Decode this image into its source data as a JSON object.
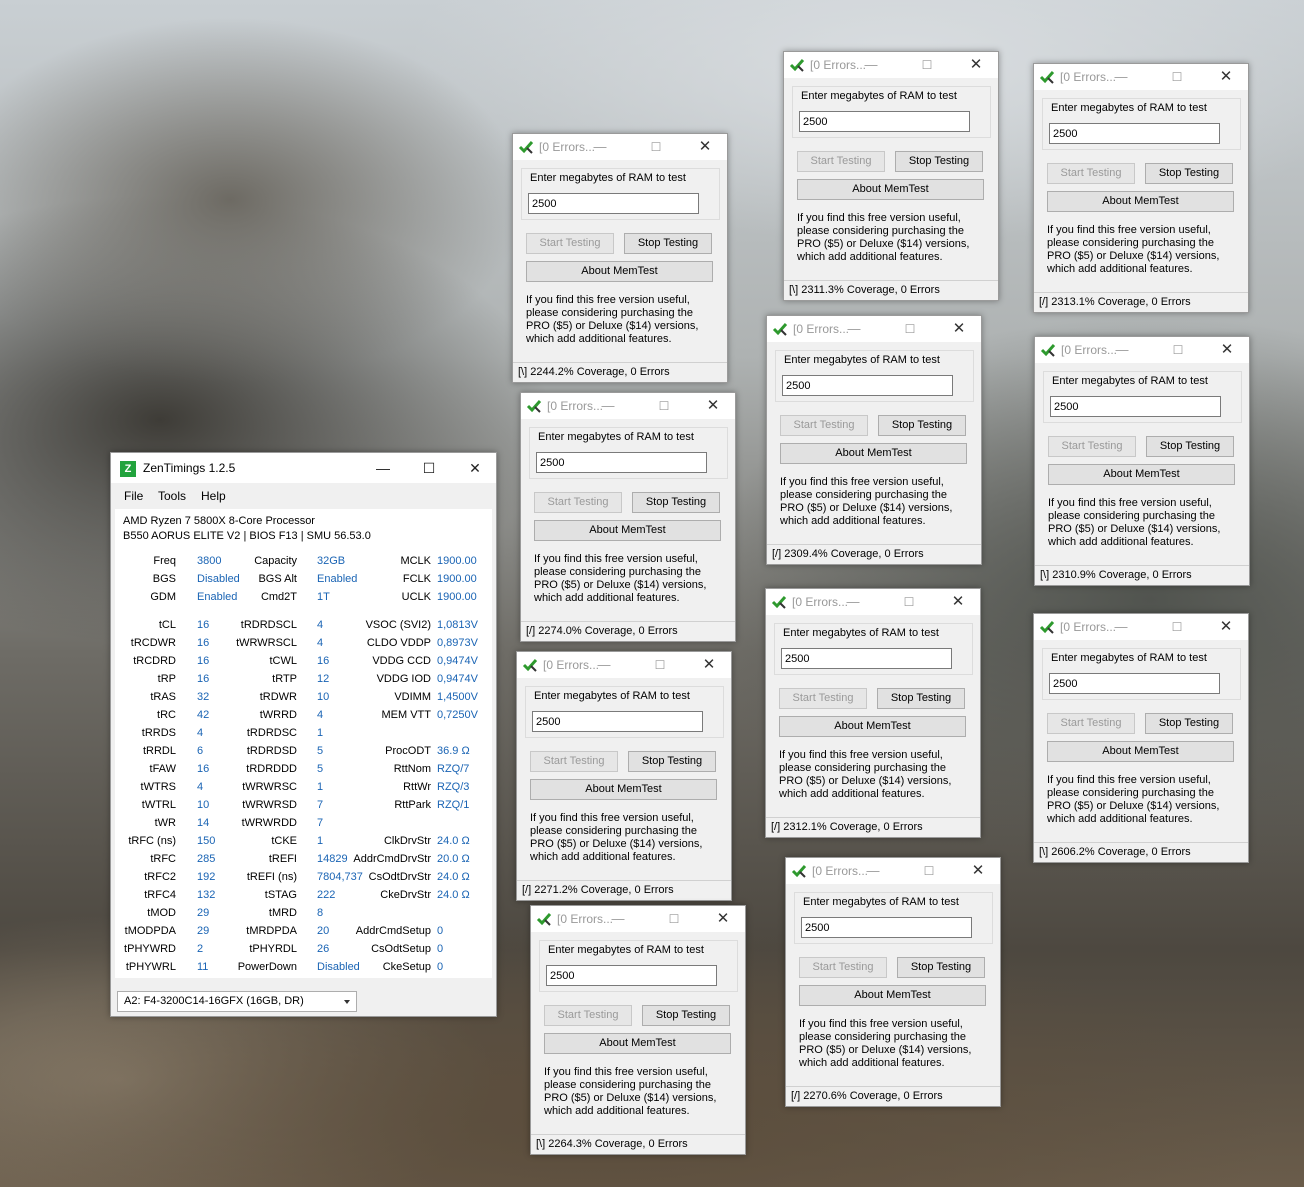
{
  "memtest_common": {
    "title": "[0 Errors...",
    "group_label": "Enter megabytes of RAM to test",
    "ram_value": "2500",
    "start_label": "Start Testing",
    "stop_label": "Stop Testing",
    "about_label": "About MemTest",
    "message": "If you find this free version useful, please considering purchasing the PRO ($5) or Deluxe ($14) versions, which add additional features."
  },
  "memtest_windows": [
    {
      "status": "[\\]   2244.2% Coverage, 0 Errors"
    },
    {
      "status": "[/]   2274.0% Coverage, 0 Errors"
    },
    {
      "status": "[/]   2271.2% Coverage, 0 Errors"
    },
    {
      "status": "[\\]   2264.3% Coverage, 0 Errors"
    },
    {
      "status": "[\\]   2311.3% Coverage, 0 Errors"
    },
    {
      "status": "[/]   2309.4% Coverage, 0 Errors"
    },
    {
      "status": "[/]   2312.1% Coverage, 0 Errors"
    },
    {
      "status": "[/]   2270.6% Coverage, 0 Errors"
    },
    {
      "status": "[/]   2313.1% Coverage, 0 Errors"
    },
    {
      "status": "[\\]   2310.9% Coverage, 0 Errors"
    },
    {
      "status": "[\\]   2606.2% Coverage, 0 Errors"
    }
  ],
  "zentimings": {
    "title": "ZenTimings 1.2.5",
    "menu": [
      "File",
      "Tools",
      "Help"
    ],
    "cpu": "AMD Ryzen 7 5800X 8-Core Processor",
    "board": "B550 AORUS ELITE V2 | BIOS F13 | SMU 56.53.0",
    "rows": [
      [
        "Freq",
        "3800",
        "Capacity",
        "32GB",
        "MCLK",
        "1900.00"
      ],
      [
        "BGS",
        "Disabled",
        "BGS Alt",
        "Enabled",
        "FCLK",
        "1900.00"
      ],
      [
        "GDM",
        "Enabled",
        "Cmd2T",
        "1T",
        "UCLK",
        "1900.00"
      ],
      [
        "tCL",
        "16",
        "tRDRDSCL",
        "4",
        "VSOC (SVI2)",
        "1,0813V"
      ],
      [
        "tRCDWR",
        "16",
        "tWRWRSCL",
        "4",
        "CLDO VDDP",
        "0,8973V"
      ],
      [
        "tRCDRD",
        "16",
        "tCWL",
        "16",
        "VDDG CCD",
        "0,9474V"
      ],
      [
        "tRP",
        "16",
        "tRTP",
        "12",
        "VDDG IOD",
        "0,9474V"
      ],
      [
        "tRAS",
        "32",
        "tRDWR",
        "10",
        "VDIMM",
        "1,4500V"
      ],
      [
        "tRC",
        "42",
        "tWRRD",
        "4",
        "MEM VTT",
        "0,7250V"
      ],
      [
        "tRRDS",
        "4",
        "tRDRDSC",
        "1",
        "",
        ""
      ],
      [
        "tRRDL",
        "6",
        "tRDRDSD",
        "5",
        "ProcODT",
        "36.9 Ω"
      ],
      [
        "tFAW",
        "16",
        "tRDRDDD",
        "5",
        "RttNom",
        "RZQ/7"
      ],
      [
        "tWTRS",
        "4",
        "tWRWRSC",
        "1",
        "RttWr",
        "RZQ/3"
      ],
      [
        "tWTRL",
        "10",
        "tWRWRSD",
        "7",
        "RttPark",
        "RZQ/1"
      ],
      [
        "tWR",
        "14",
        "tWRWRDD",
        "7",
        "",
        ""
      ],
      [
        "tRFC (ns)",
        "150",
        "tCKE",
        "1",
        "ClkDrvStr",
        "24.0 Ω"
      ],
      [
        "tRFC",
        "285",
        "tREFI",
        "14829",
        "AddrCmdDrvStr",
        "20.0 Ω"
      ],
      [
        "tRFC2",
        "192",
        "tREFI (ns)",
        "7804,737",
        "CsOdtDrvStr",
        "24.0 Ω"
      ],
      [
        "tRFC4",
        "132",
        "tSTAG",
        "222",
        "CkeDrvStr",
        "24.0 Ω"
      ],
      [
        "tMOD",
        "29",
        "tMRD",
        "8",
        "",
        ""
      ],
      [
        "tMODPDA",
        "29",
        "tMRDPDA",
        "20",
        "AddrCmdSetup",
        "0"
      ],
      [
        "tPHYWRD",
        "2",
        "tPHYRDL",
        "26",
        "CsOdtSetup",
        "0"
      ],
      [
        "tPHYWRL",
        "11",
        "PowerDown",
        "Disabled",
        "CkeSetup",
        "0"
      ]
    ],
    "module": "A2: F4-3200C14-16GFX (16GB, DR)"
  }
}
